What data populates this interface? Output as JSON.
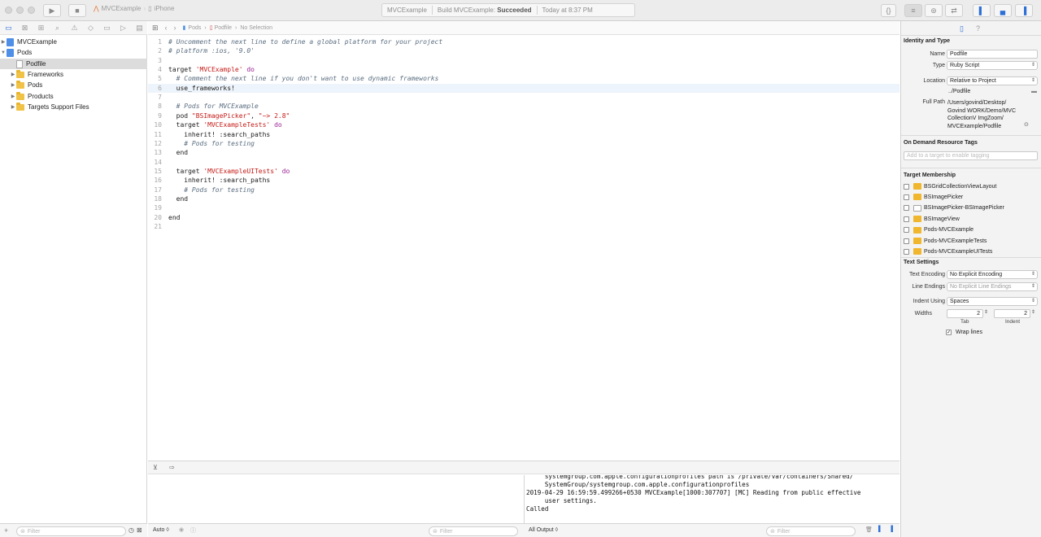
{
  "toolbar": {
    "scheme": "MVCExample",
    "device": "iPhone",
    "activity_project": "MVCExample",
    "activity_status_prefix": "Build MVCExample:",
    "activity_status": "Succeeded",
    "activity_time": "Today at 8:37 PM"
  },
  "navigator": {
    "items": [
      {
        "label": "MVCExample",
        "icon": "project-icon"
      },
      {
        "label": "Pods",
        "icon": "project-icon"
      },
      {
        "label": "Podfile",
        "icon": "file-icon"
      },
      {
        "label": "Frameworks",
        "icon": "folder-icon"
      },
      {
        "label": "Pods",
        "icon": "folder-icon"
      },
      {
        "label": "Products",
        "icon": "folder-icon"
      },
      {
        "label": "Targets Support Files",
        "icon": "folder-icon"
      }
    ],
    "filter_placeholder": "Filter"
  },
  "jumpbar": {
    "crumb1": "Pods",
    "crumb2": "Podfile",
    "crumb3": "No Selection"
  },
  "editor": {
    "lines": [
      {
        "n": "1",
        "text": "# Uncomment the next line to define a global platform for your project"
      },
      {
        "n": "2",
        "text": "# platform :ios, '9.0'"
      },
      {
        "n": "3",
        "text": ""
      },
      {
        "n": "4",
        "pre": "target ",
        "str": "'MVCExample'",
        "post": " do"
      },
      {
        "n": "5",
        "text": "  # Comment the next line if you don't want to use dynamic frameworks"
      },
      {
        "n": "6",
        "pre": "  use_frameworks!"
      },
      {
        "n": "7",
        "text": ""
      },
      {
        "n": "8",
        "text": "  # Pods for MVCExample"
      },
      {
        "n": "9",
        "pre": "  pod ",
        "str": "\"BSImagePicker\"",
        "mid": ", ",
        "str2": "\"~> 2.8\""
      },
      {
        "n": "10",
        "pre": "  target ",
        "str": "'MVCExampleTests'",
        "post": " do"
      },
      {
        "n": "11",
        "pre": "    inherit! :search_paths"
      },
      {
        "n": "12",
        "text": "    # Pods for testing"
      },
      {
        "n": "13",
        "pre": "  end"
      },
      {
        "n": "14",
        "text": ""
      },
      {
        "n": "15",
        "pre": "  target ",
        "str": "'MVCExampleUITests'",
        "post": " do"
      },
      {
        "n": "16",
        "pre": "    inherit! :search_paths"
      },
      {
        "n": "17",
        "text": "    # Pods for testing"
      },
      {
        "n": "18",
        "pre": "  end"
      },
      {
        "n": "19",
        "text": ""
      },
      {
        "n": "20",
        "pre": "end"
      },
      {
        "n": "21",
        "text": ""
      }
    ]
  },
  "debug": {
    "auto_label": "Auto ◊",
    "filter_placeholder": "Filter",
    "output_label": "All Output ◊",
    "console_lines": [
      "     systemgroup.com.apple.configurationprofiles path is /private/var/containers/Shared/",
      "     SystemGroup/systemgroup.com.apple.configurationprofiles",
      "2019-04-29 16:59:59.499266+0530 MVCExample[1000:307707] [MC] Reading from public effective",
      "     user settings.",
      "Called"
    ]
  },
  "inspector": {
    "identity_title": "Identity and Type",
    "name_label": "Name",
    "name_value": "Podfile",
    "type_label": "Type",
    "type_value": "Ruby Script",
    "location_label": "Location",
    "location_value": "Relative to Project",
    "relative_path": "../Podfile",
    "fullpath_label": "Full Path",
    "fullpath_lines": [
      "/Users/govind/Desktop/",
      "Govind WORK/Demo/MVC",
      "CollectionV ImgZoom/",
      "MVCExample/Podfile"
    ],
    "ondemand_title": "On Demand Resource Tags",
    "ondemand_placeholder": "Add to a target to enable tagging",
    "membership_title": "Target Membership",
    "members": [
      {
        "label": "BSGridCollectionViewLayout",
        "icon": "orange"
      },
      {
        "label": "BSImagePicker",
        "icon": "orange"
      },
      {
        "label": "BSImagePicker-BSImagePicker",
        "icon": "white"
      },
      {
        "label": "BSImageView",
        "icon": "orange"
      },
      {
        "label": "Pods-MVCExample",
        "icon": "orange"
      },
      {
        "label": "Pods-MVCExampleTests",
        "icon": "orange"
      },
      {
        "label": "Pods-MVCExampleUITests",
        "icon": "orange"
      }
    ],
    "text_settings_title": "Text Settings",
    "encoding_label": "Text Encoding",
    "encoding_value": "No Explicit Encoding",
    "endings_label": "Line Endings",
    "endings_value": "No Explicit Line Endings",
    "indent_label": "Indent Using",
    "indent_value": "Spaces",
    "widths_label": "Widths",
    "tab_value": "2",
    "indent_width_value": "2",
    "tab_caption": "Tab",
    "indent_caption": "Indent",
    "wrap_label": "Wrap lines"
  }
}
